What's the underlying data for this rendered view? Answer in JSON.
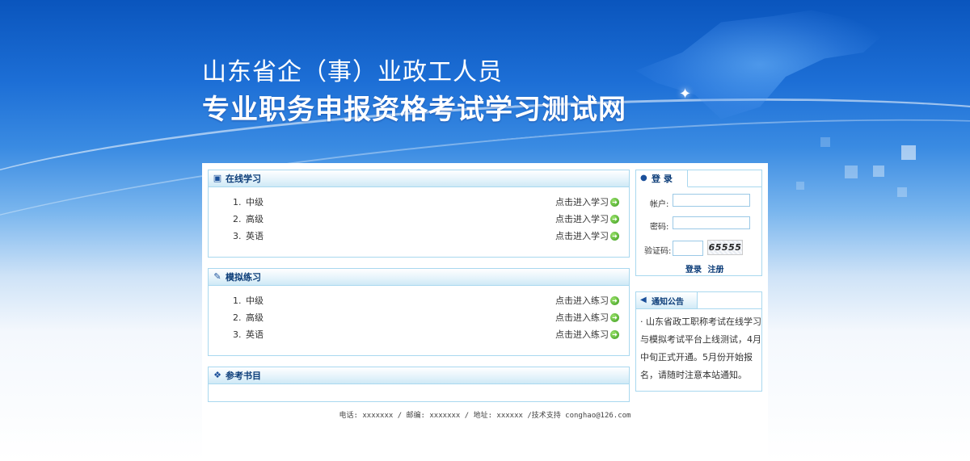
{
  "header": {
    "title_line1": "山东省企（事）业政工人员",
    "title_line2": "专业职务申报资格考试学习测试网"
  },
  "online_study": {
    "title": "在线学习",
    "items": [
      {
        "num": "1.",
        "name": "中级",
        "link": "点击进入学习"
      },
      {
        "num": "2.",
        "name": "高级",
        "link": "点击进入学习"
      },
      {
        "num": "3.",
        "name": "英语",
        "link": "点击进入学习"
      }
    ]
  },
  "mock_practice": {
    "title": "模拟练习",
    "items": [
      {
        "num": "1.",
        "name": "中级",
        "link": "点击进入练习"
      },
      {
        "num": "2.",
        "name": "高级",
        "link": "点击进入练习"
      },
      {
        "num": "3.",
        "name": "英语",
        "link": "点击进入练习"
      }
    ]
  },
  "reference_books": {
    "title": "参考书目"
  },
  "login": {
    "title": "登 录",
    "account_label": "帐户:",
    "account_value": "",
    "password_label": "密码:",
    "password_value": "",
    "captcha_label": "验证码:",
    "captcha_value": "",
    "captcha_text": "65555",
    "login_label": "登录",
    "register_label": "注册"
  },
  "notice": {
    "title": "通知公告",
    "text": "· 山东省政工职称考试在线学习与模拟考试平台上线测试，4月中旬正式开通。5月份开始报名，请随时注意本站通知。"
  },
  "footer": {
    "text": "电话: xxxxxxx / 邮编: xxxxxxx / 地址: xxxxxx /技术支持 conghao@126.com"
  },
  "colors": {
    "accent": "#0b3c78",
    "border": "#a9d8ef",
    "banner_blue": "#1d6fd6"
  }
}
